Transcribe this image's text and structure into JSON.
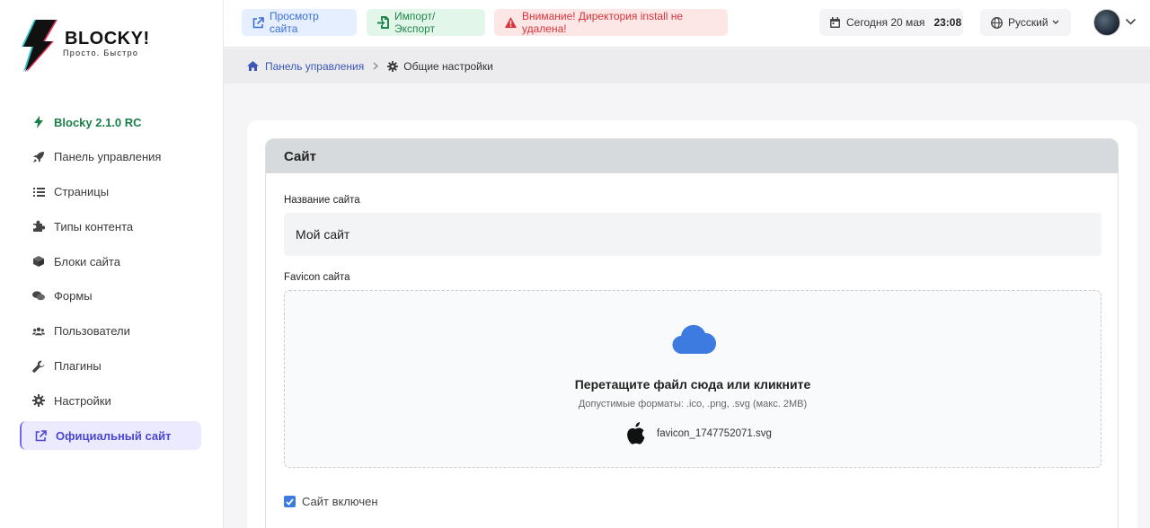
{
  "brand": {
    "name": "BLOCKY!",
    "tagline": "Просто. Быстро"
  },
  "sidebar": {
    "items": [
      {
        "label": "Blocky 2.1.0 RC",
        "icon": "bolt-icon"
      },
      {
        "label": "Панель управления",
        "icon": "rocket-icon"
      },
      {
        "label": "Страницы",
        "icon": "list-icon"
      },
      {
        "label": "Типы контента",
        "icon": "puzzle-icon"
      },
      {
        "label": "Блоки сайта",
        "icon": "cube-icon"
      },
      {
        "label": "Формы",
        "icon": "comments-icon"
      },
      {
        "label": "Пользователи",
        "icon": "users-icon"
      },
      {
        "label": "Плагины",
        "icon": "wrench-icon"
      },
      {
        "label": "Настройки",
        "icon": "gear-icon"
      },
      {
        "label": "Официальный сайт",
        "icon": "external-link-icon"
      }
    ]
  },
  "header": {
    "view_site": "Просмотр сайта",
    "import_export": "Импорт/Экспорт",
    "warning": "Внимание! Директория install не удалена!",
    "date": "Сегодня 20 мая",
    "time": "23:08",
    "language": "Русский"
  },
  "breadcrumb": {
    "home": "Панель управления",
    "current": "Общие настройки"
  },
  "panel": {
    "title": "Сайт",
    "site_name_label": "Название сайта",
    "site_name_value": "Мой сайт",
    "favicon_label": "Favicon сайта",
    "dropzone_title": "Перетащите файл сюда или кликните",
    "dropzone_hint": "Допустимые форматы: .ico, .png, .svg (макс. 2MB)",
    "file_name": "favicon_1747752071.svg",
    "site_enabled_label": "Сайт включен",
    "site_enabled": true
  },
  "colors": {
    "accent": "#4b47d6",
    "version_green": "#1b7f4a",
    "warning_red": "#d9343a",
    "cloud_blue": "#3d7be0"
  }
}
